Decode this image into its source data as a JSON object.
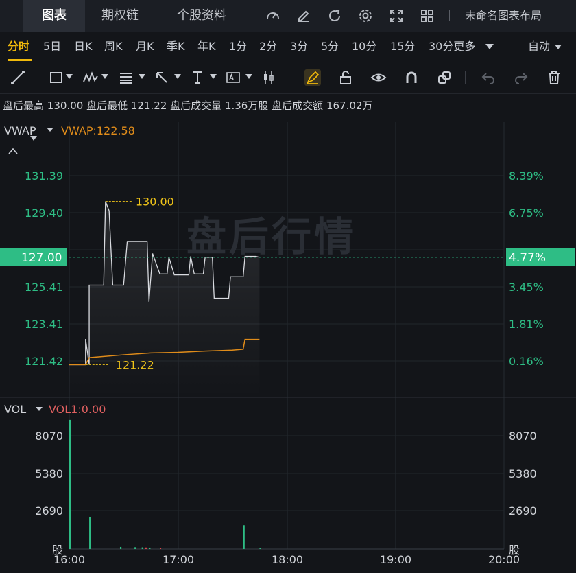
{
  "top_tabs": [
    "图表",
    "期权链",
    "个股资料"
  ],
  "layout_name": "未命名图表布局",
  "periods": [
    "分时",
    "5日",
    "日K",
    "周K",
    "月K",
    "季K",
    "年K",
    "1分",
    "2分",
    "3分",
    "5分",
    "10分",
    "15分",
    "30分更多"
  ],
  "period_dropdown_icon": "chevron-down-icon",
  "auto_label": "自动",
  "info": {
    "high_label": "盘后最高",
    "high": "130.00",
    "low_label": "盘后最低",
    "low": "121.22",
    "vol_label": "盘后成交量",
    "vol": "1.36万股",
    "amt_label": "盘后成交额",
    "amt": "167.02万"
  },
  "main_indicator": {
    "name": "VWAP",
    "value_text": "VWAP:122.58"
  },
  "vol_indicator": {
    "name": "VOL",
    "value_text": "VOL1:0.00"
  },
  "watermark": "盘后行情",
  "price_axis_left": [
    "131.39",
    "129.40",
    "125.41",
    "123.41",
    "121.42"
  ],
  "price_axis_right": [
    "8.39%",
    "6.75%",
    "3.45%",
    "1.81%",
    "0.16%"
  ],
  "current_price": "127.00",
  "current_pct": "4.77%",
  "high_marker": "130.00",
  "low_marker": "121.22",
  "vol_axis": [
    "8070",
    "5380",
    "2690"
  ],
  "vol_unit": "股",
  "time_axis": [
    "16:00",
    "17:00",
    "18:00",
    "19:00",
    "20:00"
  ],
  "colors": {
    "accent": "#f0b90b",
    "up": "#2ebd85",
    "vwap": "#e08c1a",
    "price_line": "#d9dbe0",
    "bg": "#131519"
  },
  "chart_data": {
    "type": "line",
    "x_range": [
      "16:00",
      "20:00"
    ],
    "ylim": [
      120.6,
      132.2
    ],
    "price": [
      {
        "t": "16:00",
        "v": 121.22
      },
      {
        "t": "16:09",
        "v": 121.22
      },
      {
        "t": "16:09",
        "v": 122.6
      },
      {
        "t": "16:11",
        "v": 121.22
      },
      {
        "t": "16:11",
        "v": 125.5
      },
      {
        "t": "16:19",
        "v": 125.5
      },
      {
        "t": "16:20",
        "v": 130.0
      },
      {
        "t": "16:22",
        "v": 129.5
      },
      {
        "t": "16:24",
        "v": 125.5
      },
      {
        "t": "16:30",
        "v": 125.5
      },
      {
        "t": "16:32",
        "v": 127.85
      },
      {
        "t": "16:43",
        "v": 127.85
      },
      {
        "t": "16:44",
        "v": 124.6
      },
      {
        "t": "16:46",
        "v": 127.2
      },
      {
        "t": "16:50",
        "v": 126.1
      },
      {
        "t": "16:54",
        "v": 126.1
      },
      {
        "t": "16:55",
        "v": 127.0
      },
      {
        "t": "16:58",
        "v": 126.05
      },
      {
        "t": "17:06",
        "v": 126.05
      },
      {
        "t": "17:07",
        "v": 127.05
      },
      {
        "t": "17:09",
        "v": 126.1
      },
      {
        "t": "17:14",
        "v": 126.1
      },
      {
        "t": "17:15",
        "v": 127.0
      },
      {
        "t": "17:19",
        "v": 127.0
      },
      {
        "t": "17:20",
        "v": 124.8
      },
      {
        "t": "17:28",
        "v": 124.8
      },
      {
        "t": "17:29",
        "v": 125.95
      },
      {
        "t": "17:36",
        "v": 125.95
      },
      {
        "t": "17:37",
        "v": 127.05
      },
      {
        "t": "17:43",
        "v": 127.05
      },
      {
        "t": "17:45",
        "v": 127.0
      }
    ],
    "vwap": [
      {
        "t": "16:00",
        "v": 121.22
      },
      {
        "t": "16:09",
        "v": 121.22
      },
      {
        "t": "16:11",
        "v": 121.6
      },
      {
        "t": "16:30",
        "v": 121.75
      },
      {
        "t": "16:45",
        "v": 121.85
      },
      {
        "t": "17:00",
        "v": 121.88
      },
      {
        "t": "17:15",
        "v": 121.95
      },
      {
        "t": "17:30",
        "v": 122.0
      },
      {
        "t": "17:36",
        "v": 122.05
      },
      {
        "t": "17:37",
        "v": 122.58
      },
      {
        "t": "17:45",
        "v": 122.58
      }
    ],
    "volume": [
      {
        "t": "16:00",
        "v": 9200
      },
      {
        "t": "16:11",
        "v": 2300
      },
      {
        "t": "16:28",
        "v": 150
      },
      {
        "t": "16:36",
        "v": 130
      },
      {
        "t": "16:40",
        "v": 120
      },
      {
        "t": "16:44",
        "v": 100
      },
      {
        "t": "17:36",
        "v": 1700
      },
      {
        "t": "17:45",
        "v": 80
      }
    ],
    "vol_ylim": [
      0,
      9200
    ]
  }
}
